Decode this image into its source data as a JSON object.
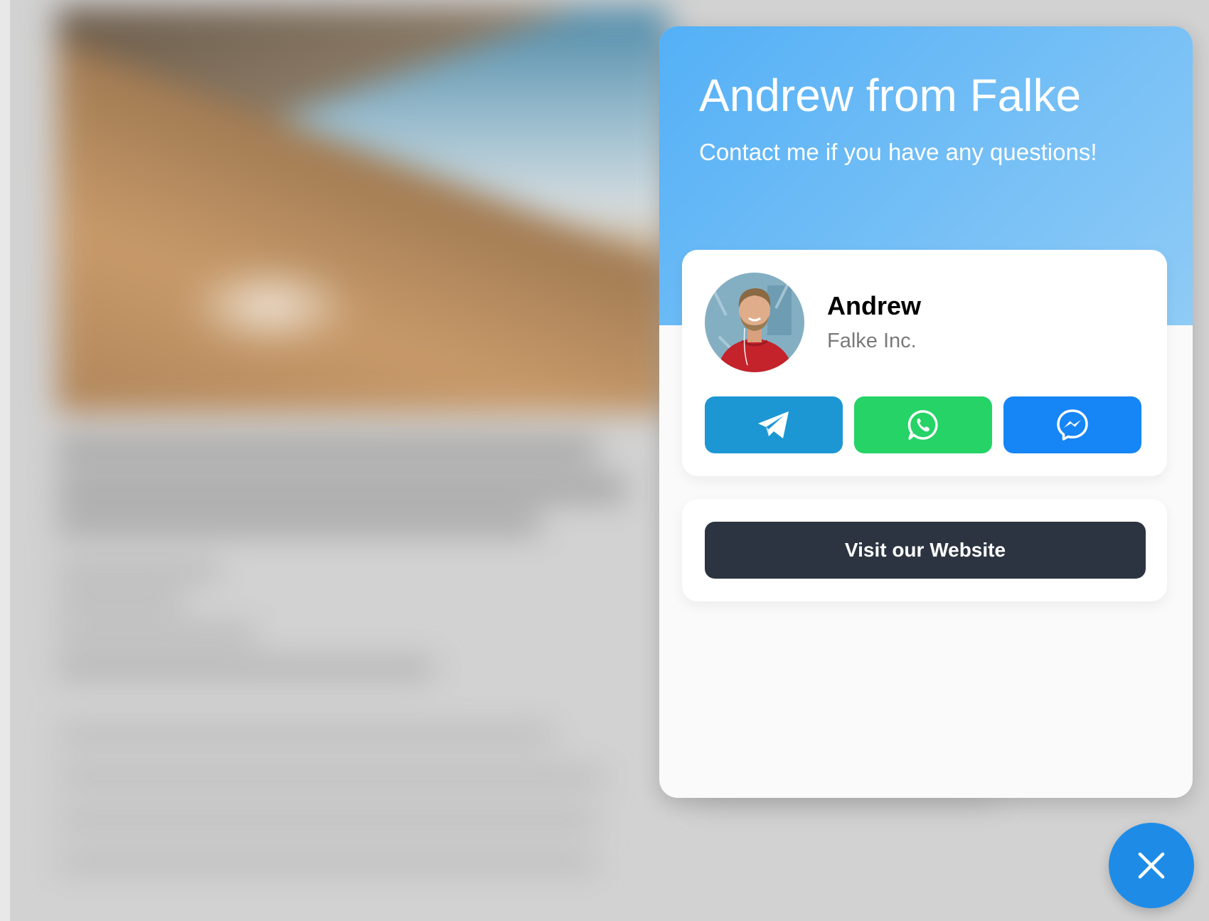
{
  "widget": {
    "title": "Andrew from Falke",
    "subtitle": "Contact me if you have any questions!",
    "header_gradient": [
      "#54b0f6",
      "#8fcbf6"
    ]
  },
  "agent": {
    "name": "Andrew",
    "company": "Falke Inc.",
    "avatar_icon": "person-photo"
  },
  "channels": [
    {
      "name": "Telegram",
      "icon": "telegram-icon",
      "color": "#1c97d4"
    },
    {
      "name": "WhatsApp",
      "icon": "whatsapp-icon",
      "color": "#25d366"
    },
    {
      "name": "Messenger",
      "icon": "messenger-icon",
      "color": "#1685f5"
    }
  ],
  "website_button": {
    "label": "Visit our Website",
    "color": "#2d3441"
  },
  "close_button": {
    "icon": "close-icon",
    "color": "#1e8ce7"
  }
}
